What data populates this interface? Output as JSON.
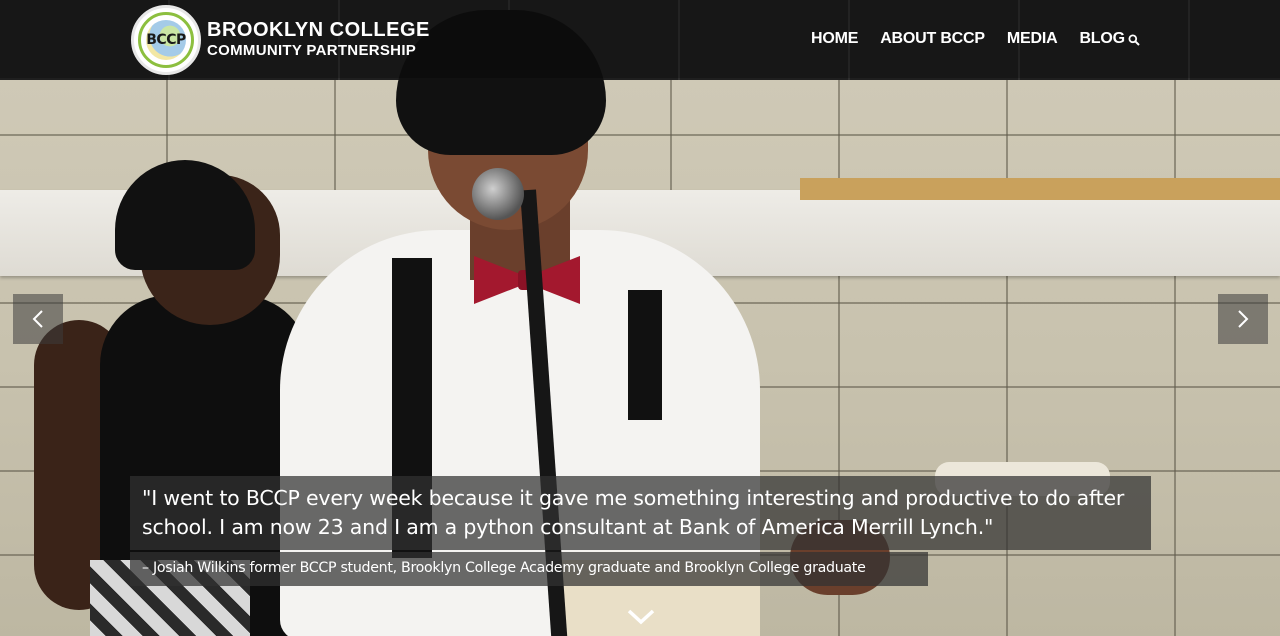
{
  "brand": {
    "logo_text": "BCCP",
    "name_line1": "BROOKLYN COLLEGE",
    "name_line2": "COMMUNITY PARTNERSHIP"
  },
  "nav": {
    "items": [
      {
        "label": "HOME"
      },
      {
        "label": "ABOUT BCCP"
      },
      {
        "label": "MEDIA"
      },
      {
        "label": "BLOG"
      }
    ],
    "search_icon": "search-icon"
  },
  "carousel": {
    "prev_icon": "chevron-left-icon",
    "next_icon": "chevron-right-icon",
    "quote": "\"I went to BCCP every week because it gave me something interesting and productive to do after school. I am now 23 and I am a python consultant at Bank of America Merrill Lynch.\"",
    "attribution": "– Josiah Wilkins former BCCP student, Brooklyn College Academy graduate and Brooklyn College graduate",
    "scroll_icon": "chevron-down-icon"
  },
  "colors": {
    "overlay": "#323232",
    "text": "#ffffff",
    "bowtie": "#a3182e",
    "logo_accent": "#8cbf3f"
  }
}
